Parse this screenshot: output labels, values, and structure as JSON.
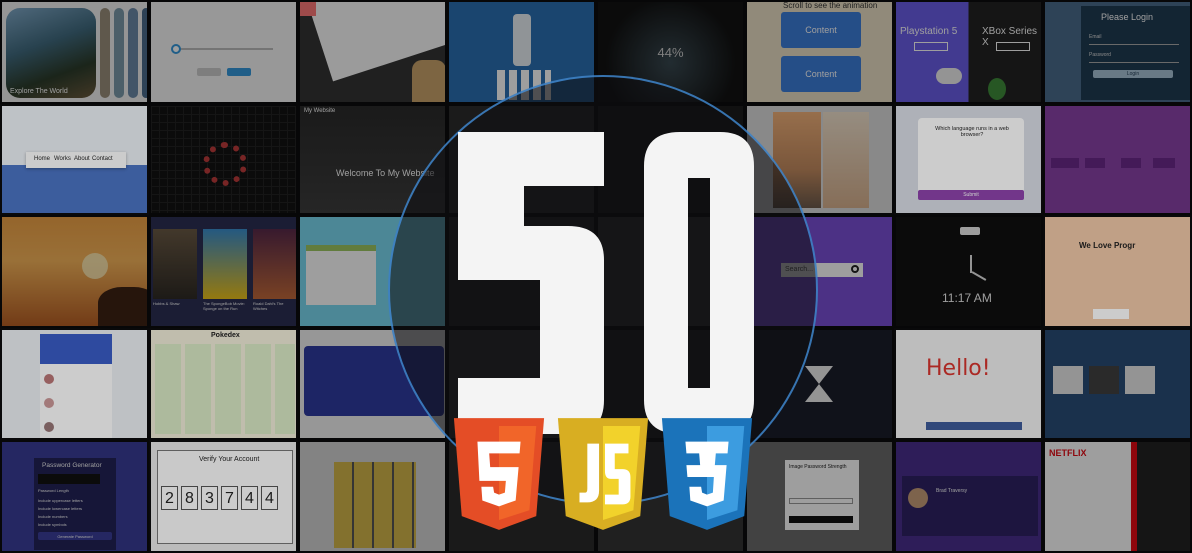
{
  "title_number": "50",
  "badges": [
    {
      "name": "html5",
      "glyph": "5",
      "color": "#e44d26",
      "shade": "#f16529"
    },
    {
      "name": "javascript",
      "glyph": "JS",
      "color": "#e5b827",
      "shade": "#f2d22b"
    },
    {
      "name": "css3",
      "glyph": "3",
      "color": "#1b73ba",
      "shade": "#3c9ce0"
    }
  ],
  "tiles": {
    "explore": "Explore The World",
    "counter": "44%",
    "scroll_anim": "Scroll to see the animation",
    "content_1": "Content",
    "content_2": "Content",
    "ps5": "Playstation 5",
    "xbox": "XBox Series X",
    "login_title": "Please Login",
    "login_email": "Email",
    "login_password": "Password",
    "login_button": "Login",
    "nav_home": "Home",
    "nav_works": "Works",
    "nav_about": "About",
    "nav_contact": "Contact",
    "website_title": "Welcome To My Website",
    "my_website": "My Website",
    "quiz_question": "Which language runs in a web browser?",
    "quiz_submit": "Submit",
    "movie_1": "Hobbs & Shaw",
    "movie_2": "The SpongeBob Movie: Sponge on the Run",
    "movie_3": "Roald Dahl's The Witches",
    "search_placeholder": "Search...",
    "clock_time": "11:17 AM",
    "love_prog": "We Love Progr",
    "pokedex": "Pokedex",
    "hello": "Hello!",
    "password_title": "Password Generator",
    "password_length": "Password Length",
    "pw_opt_1": "Include uppercase letters",
    "pw_opt_2": "Include lowercase letters",
    "pw_opt_3": "Include numbers",
    "pw_opt_4": "Include symbols",
    "pw_generate": "Generate Password",
    "verify_title": "Verify Your Account",
    "verify_digits": [
      "2",
      "8",
      "3",
      "7",
      "4",
      "4"
    ],
    "strength_title": "Image Password Strength",
    "netflix": "NETFLIX",
    "doctor": "Brad Traversy"
  }
}
